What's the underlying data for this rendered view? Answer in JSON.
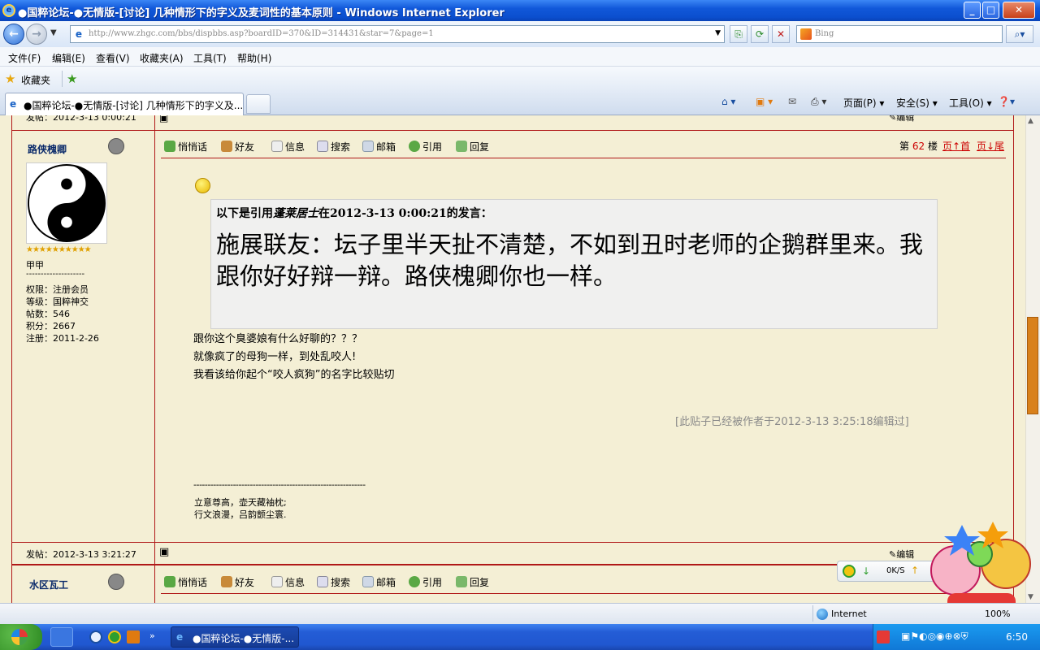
{
  "window": {
    "title": "●国粹论坛-●无情版-[讨论] 几种情形下的字义及麦词性的基本原则 - Windows Internet Explorer"
  },
  "address": {
    "url": "http://www.zhgc.com/bbs/dispbbs.asp?boardID=370&ID=314431&star=7&page=1",
    "search_placeholder": "Bing"
  },
  "menu": {
    "items": [
      "文件(F)",
      "编辑(E)",
      "查看(V)",
      "收藏夹(A)",
      "工具(T)",
      "帮助(H)"
    ]
  },
  "favorites": {
    "label": "收藏夹"
  },
  "tab": {
    "title": "●国粹论坛-●无情版-[讨论] 几种情形下的字义及..."
  },
  "commandbar": {
    "page": "页面(P)",
    "safety": "安全(S)",
    "tools": "工具(O)"
  },
  "post_top": {
    "date": "发帖：2012-3-13 0:00:21",
    "edit": "编辑"
  },
  "post": {
    "username": "路侠槐卿",
    "actions": [
      "悄悄话",
      "好友",
      "信息",
      "搜索",
      "邮箱",
      "引用",
      "回复"
    ],
    "floor_prefix": "第",
    "floor_num": "62",
    "floor_suffix": "楼",
    "top_link": "页↑首",
    "bottom_link": "页↓尾",
    "rank": "甲甲",
    "divider": "--------------------",
    "info": [
      "权限：注册会员",
      "等级：国粹神交",
      "帖数：546",
      "积分：2667",
      "注册：2011-2-26"
    ],
    "quote_header_pre": "以下是引用",
    "quote_author": "蓬莱居士",
    "quote_header_post": "在2012-3-13 0:00:21的发言：",
    "quote_body": "施展联友：坛子里半天扯不清楚，不如到丑时老师的企鹅群里来。我跟你好好辩一辩。路侠槐卿你也一样。",
    "body_lines": [
      "跟你这个臭婆娘有什么好聊的？？？",
      "就像疯了的母狗一样，到处乱咬人!",
      "我看该给你起个“咬人疯狗”的名字比较贴切"
    ],
    "edited_note": "[此贴子已经被作者于2012-3-13 3:25:18编辑过]",
    "sig_divider": "-------------------------------------------------------------",
    "signature": [
      "立意尊高，壶天藏袖枕;",
      "行文浪漫，吕韵颤尘寰."
    ],
    "date": "发帖：2012-3-13 3:21:27",
    "edit": "编辑"
  },
  "next_post": {
    "username": "水区瓦工",
    "actions": [
      "悄悄话",
      "好友",
      "信息",
      "搜索",
      "邮箱",
      "引用",
      "回复"
    ]
  },
  "status": {
    "zone": "Internet",
    "zoom": "100%",
    "speed": "0K/S"
  },
  "taskbar": {
    "window": "●国粹论坛-●无情版-...",
    "clock": "6:50"
  },
  "colors": {
    "frame": "#b01818",
    "page_bg": "#f4efd5",
    "quote_bg": "#f0f0ef",
    "floor_num": "#cc0000"
  }
}
